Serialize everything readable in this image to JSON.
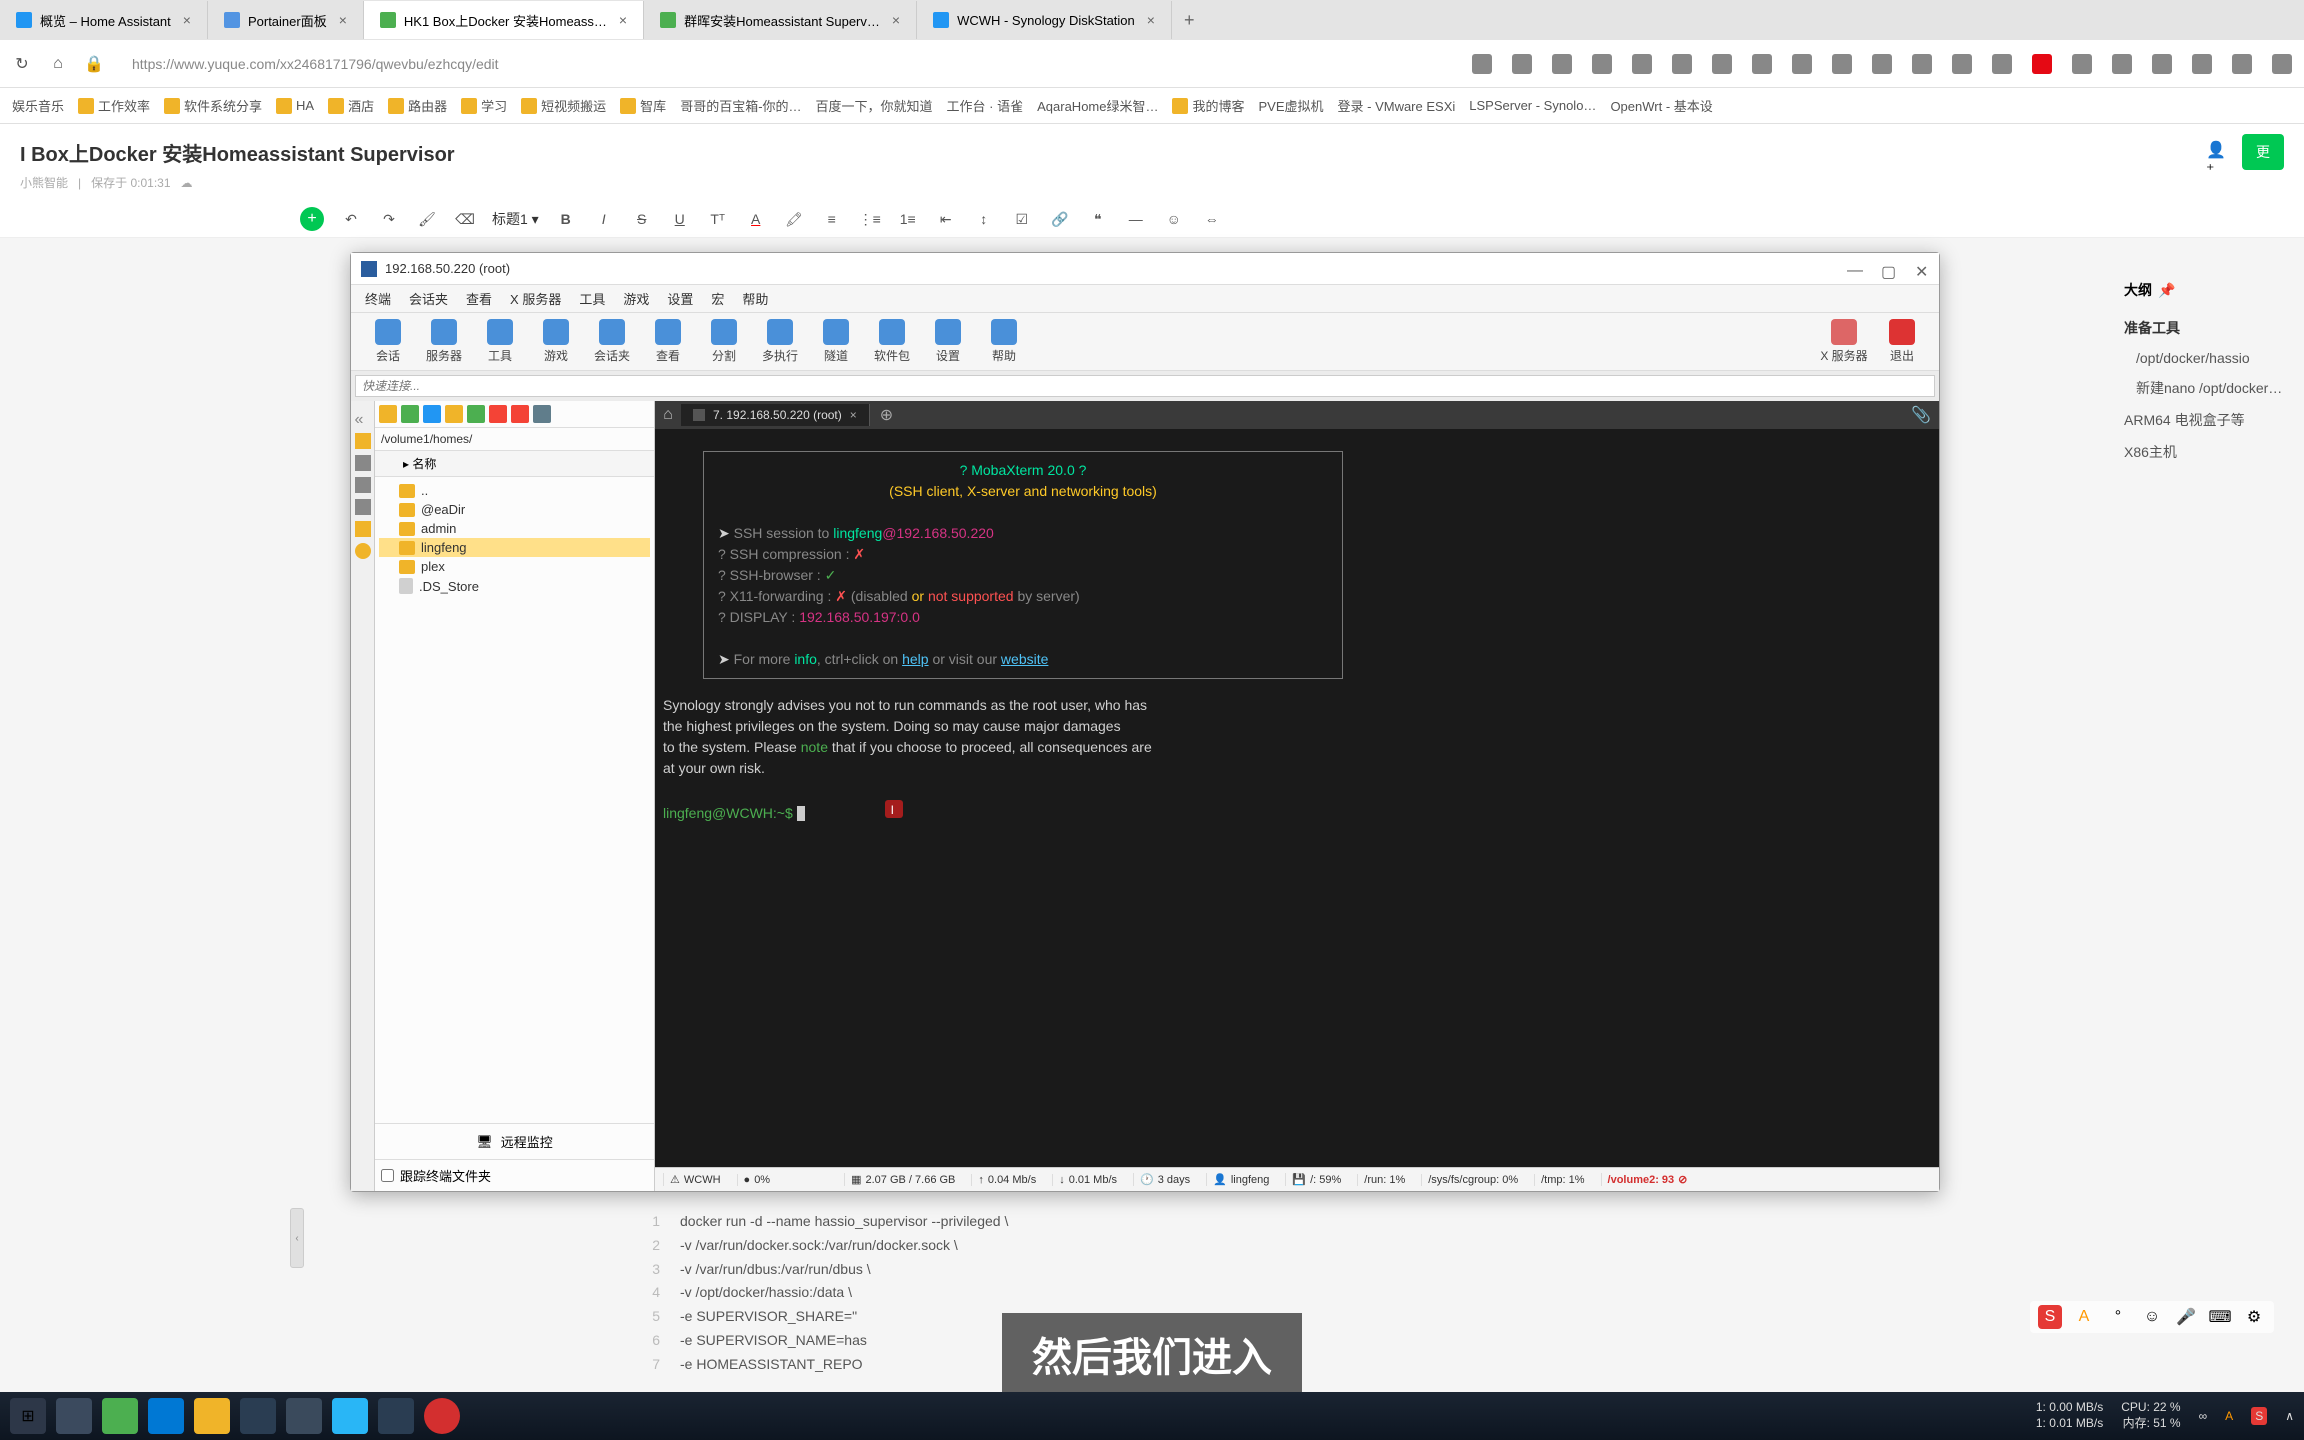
{
  "browser": {
    "tabs": [
      {
        "title": "概览 – Home Assistant"
      },
      {
        "title": "Portainer面板"
      },
      {
        "title": "HK1 Box上Docker 安装Homeass…"
      },
      {
        "title": "群晖安装Homeassistant Superv…"
      },
      {
        "title": "WCWH - Synology DiskStation"
      }
    ],
    "url": "https://www.yuque.com/xx2468171796/qwevbu/ezhcqy/edit"
  },
  "bookmarks": [
    "娱乐音乐",
    "工作效率",
    "软件系统分享",
    "HA",
    "酒店",
    "路由器",
    "学习",
    "短视频搬运",
    "智库",
    "哥哥的百宝箱-你的…",
    "百度一下，你就知道",
    "工作台 · 语雀",
    "AqaraHome绿米智…",
    "我的博客",
    "PVE虚拟机",
    "登录 - VMware ESXi",
    "LSPServer - Synolo…",
    "OpenWrt - 基本设"
  ],
  "doc": {
    "title": "I Box上Docker 安装Homeassistant Supervisor",
    "author": "小熊智能",
    "saved": "保存于 0:01:31",
    "update_btn": "更"
  },
  "toolbar": {
    "heading": "标题1"
  },
  "moba": {
    "title": "192.168.50.220 (root)",
    "menu": [
      "终端",
      "会话夹",
      "查看",
      "X 服务器",
      "工具",
      "游戏",
      "设置",
      "宏",
      "帮助"
    ],
    "tools": [
      "会话",
      "服务器",
      "工具",
      "游戏",
      "会话夹",
      "查看",
      "分割",
      "多执行",
      "隧道",
      "软件包",
      "设置",
      "帮助"
    ],
    "tools_right": [
      "X 服务器",
      "退出"
    ],
    "quick_placeholder": "快速连接...",
    "sidebar_path": "/volume1/homes/",
    "name_header": "名称",
    "tree": [
      {
        "label": "..",
        "type": "up"
      },
      {
        "label": "@eaDir",
        "type": "folder"
      },
      {
        "label": "admin",
        "type": "folder"
      },
      {
        "label": "lingfeng",
        "type": "folder",
        "selected": true
      },
      {
        "label": "plex",
        "type": "folder"
      },
      {
        "label": ".DS_Store",
        "type": "file"
      }
    ],
    "remote_monitor": "远程监控",
    "follow_folder": "跟踪终端文件夹",
    "term_tab": "7. 192.168.50.220 (root)",
    "terminal": {
      "banner1": "? MobaXterm 20.0 ?",
      "banner2": "(SSH client, X-server and networking tools)",
      "ssh_session_label": "SSH session to",
      "ssh_user": "lingfeng",
      "ssh_host": "@192.168.50.220",
      "compression": "? SSH compression :",
      "browser": "? SSH-browser     :",
      "x11": "? X11-forwarding  :",
      "x11_tail1": "(disabled",
      "x11_or": "or",
      "x11_not": "not supported",
      "x11_tail2": "by server)",
      "display": "? DISPLAY         :",
      "display_val": "192.168.50.197:0.0",
      "more1": "For more",
      "info": "info",
      "more2": ", ctrl+click on",
      "help": "help",
      "more3": "or visit our",
      "website": "website",
      "warn1": "Synology strongly advises you not to run commands as the root user, who has",
      "warn2": "the highest privileges on the system. Doing so may cause major damages",
      "warn3": "to the system. Please",
      "note": "note",
      "warn4": "that if you choose to proceed, all consequences are",
      "warn5": "at your own risk.",
      "prompt_user": "lingfeng@WCWH",
      "prompt_tail": ":~$"
    },
    "status": {
      "host": "WCWH",
      "cpu": "0%",
      "mem": "2.07 GB / 7.66 GB",
      "up": "0.04 Mb/s",
      "down": "0.01 Mb/s",
      "uptime": "3 days",
      "user": "lingfeng",
      "disk": "/: 59%",
      "run": "/run: 1%",
      "cgroup": "/sys/fs/cgroup: 0%",
      "tmp": "/tmp: 1%",
      "vol": "/volume2: 93"
    }
  },
  "outline": {
    "title": "大纲",
    "items": [
      "准备工具",
      "/opt/docker/hassio",
      "新建nano /opt/docker/hass",
      "ARM64 电视盒子等",
      "X86主机"
    ]
  },
  "code": [
    "docker run -d --name hassio_supervisor --privileged \\",
    "-v /var/run/docker.sock:/var/run/docker.sock \\",
    "-v /var/run/dbus:/var/run/dbus \\",
    "-v /opt/docker/hassio:/data \\",
    "-e SUPERVISOR_SHARE=\"",
    "-e SUPERVISOR_NAME=has",
    "-e HOMEASSISTANT_REPO"
  ],
  "subtitle": "然后我们进入",
  "taskbar": {
    "net_up": "1: 0.00 MB/s",
    "net_down": "1: 0.01 MB/s",
    "cpu": "CPU: 22 %",
    "mem": "内存: 51 %"
  }
}
